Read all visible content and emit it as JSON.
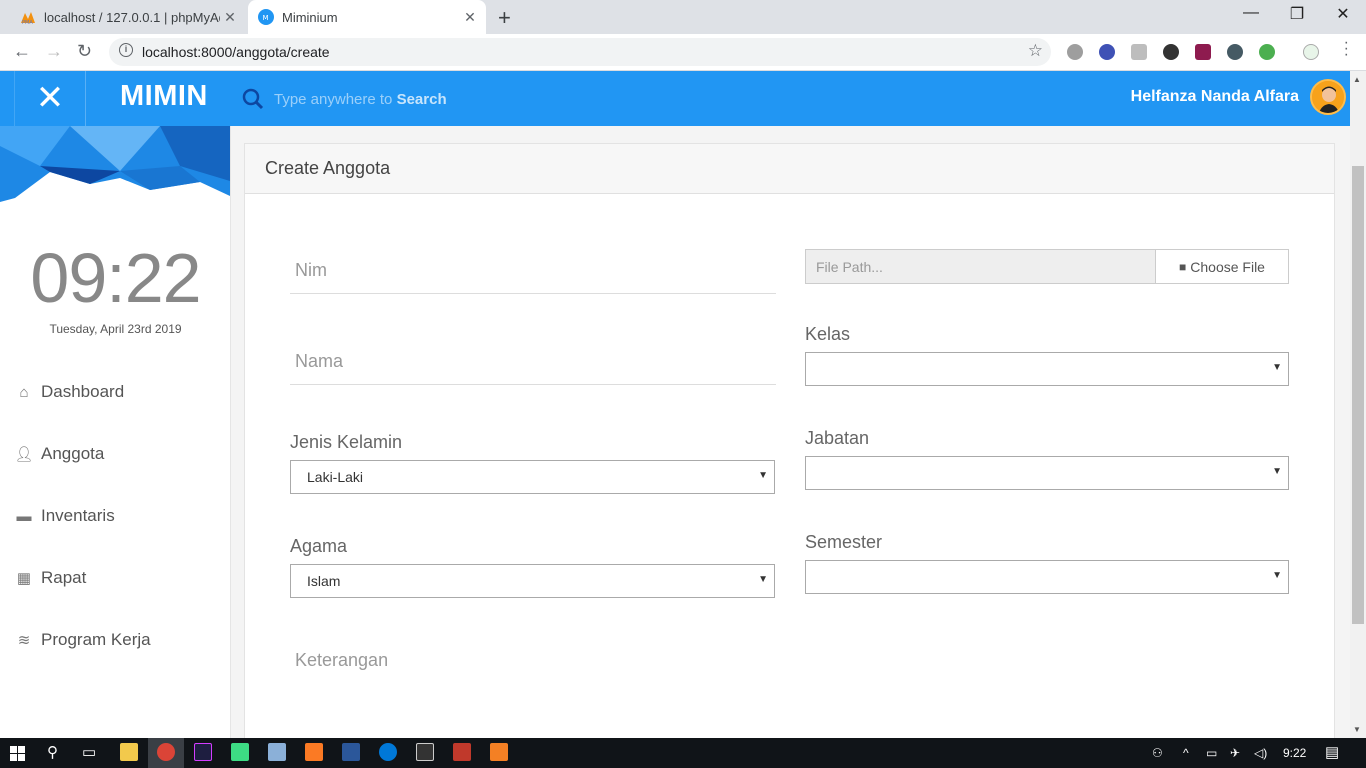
{
  "browser": {
    "tabs": [
      {
        "title": "localhost / 127.0.0.1 | phpMyAdm",
        "active": false
      },
      {
        "title": "Miminium",
        "active": true
      }
    ],
    "url": "localhost:8000/anggota/create"
  },
  "header": {
    "brand": "MIMIN",
    "search_placeholder_prefix": "Type anywhere to ",
    "search_placeholder_bold": "Search",
    "username": "Helfanza Nanda Alfara",
    "accent_color": "#2196f3"
  },
  "sidebar": {
    "clock": "09:22",
    "date": "Tuesday, April 23rd 2019",
    "items": [
      {
        "label": "Dashboard",
        "icon": "home-icon"
      },
      {
        "label": "Anggota",
        "icon": "user-icon"
      },
      {
        "label": "Inventaris",
        "icon": "archive-icon"
      },
      {
        "label": "Rapat",
        "icon": "calendar-icon"
      },
      {
        "label": "Program Kerja",
        "icon": "layers-icon"
      }
    ]
  },
  "form": {
    "title": "Create Anggota",
    "nim_placeholder": "Nim",
    "nama_placeholder": "Nama",
    "jenis_kelamin_label": "Jenis Kelamin",
    "jenis_kelamin_value": "Laki-Laki",
    "agama_label": "Agama",
    "agama_value": "Islam",
    "keterangan_placeholder": "Keterangan",
    "file_path_placeholder": "File Path...",
    "choose_file_label": "Choose File",
    "kelas_label": "Kelas",
    "kelas_value": "",
    "jabatan_label": "Jabatan",
    "jabatan_value": "",
    "semester_label": "Semester",
    "semester_value": ""
  },
  "taskbar": {
    "time": "9:22"
  }
}
